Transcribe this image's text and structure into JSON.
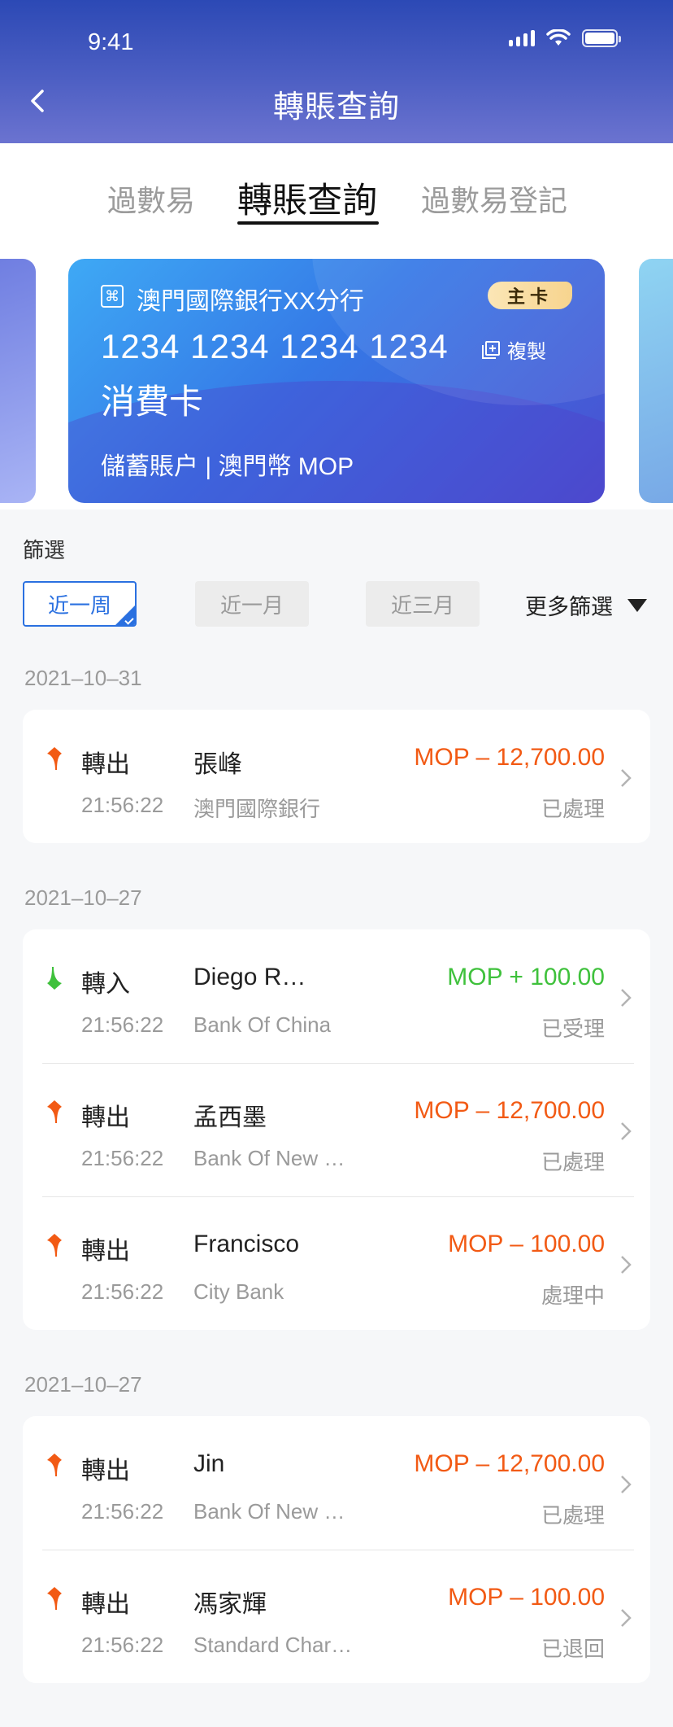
{
  "status_bar": {
    "time": "9:41"
  },
  "header": {
    "title": "轉賬查詢"
  },
  "tabs": [
    {
      "label": "過數易"
    },
    {
      "label": "轉賬查詢"
    },
    {
      "label": "過數易登記"
    }
  ],
  "card": {
    "bank_name": "澳門國際銀行XX分行",
    "badge": "主卡",
    "number": "1234 1234 1234 1234",
    "copy_label": "複製",
    "type": "消費卡",
    "account": "儲蓄賬户 | 澳門幣 MOP"
  },
  "filters": {
    "title": "篩選",
    "chips": [
      "近一周",
      "近一月",
      "近三月"
    ],
    "selected": "近一周",
    "more": "更多篩選"
  },
  "colors": {
    "out": "#f25a14",
    "in": "#3fc13c",
    "accent": "#2a70e0"
  },
  "groups": [
    {
      "date": "2021–10–31",
      "items": [
        {
          "direction": "轉出",
          "name": "張峰",
          "amount": "MOP – 12,700.00",
          "time": "21:56:22",
          "bank": "澳門國際銀行",
          "status": "已處理"
        }
      ]
    },
    {
      "date": "2021–10–27",
      "items": [
        {
          "direction": "轉入",
          "name": "Diego R…",
          "amount": "MOP + 100.00",
          "time": "21:56:22",
          "bank": "Bank Of China",
          "status": "已受理"
        },
        {
          "direction": "轉出",
          "name": "孟西墨",
          "amount": "MOP – 12,700.00",
          "time": "21:56:22",
          "bank": "Bank Of New …",
          "status": "已處理"
        },
        {
          "direction": "轉出",
          "name": "Francisco",
          "amount": "MOP – 100.00",
          "time": "21:56:22",
          "bank": "City Bank",
          "status": "處理中"
        }
      ]
    },
    {
      "date": "2021–10–27",
      "items": [
        {
          "direction": "轉出",
          "name": "Jin",
          "amount": "MOP – 12,700.00",
          "time": "21:56:22",
          "bank": "Bank Of New …",
          "status": "已處理"
        },
        {
          "direction": "轉出",
          "name": "馮家輝",
          "amount": "MOP – 100.00",
          "time": "21:56:22",
          "bank": "Standard Char…",
          "status": "已退回"
        }
      ]
    }
  ]
}
